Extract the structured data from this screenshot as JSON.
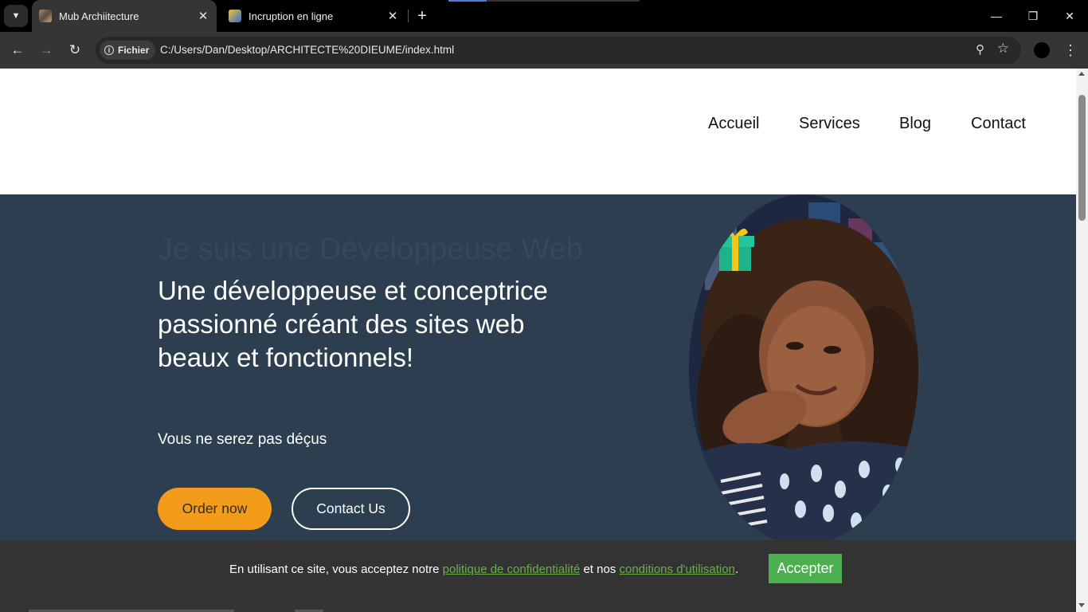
{
  "browser": {
    "tabs": [
      {
        "title": "Mub Archiitecture",
        "active": true
      },
      {
        "title": "Incruption en ligne",
        "active": false
      }
    ],
    "site_chip": "Fichier",
    "url": "C:/Users/Dan/Desktop/ARCHITECTE%20DIEUME/index.html",
    "icons": {
      "tab_list": "chevron-down-icon",
      "close": "close-icon",
      "new_tab": "plus-icon",
      "back": "arrow-left-icon",
      "forward": "arrow-right-icon",
      "reload": "reload-icon",
      "zoom": "zoom-icon",
      "bookmark": "star-icon",
      "menu": "kebab-menu-icon"
    }
  },
  "nav": {
    "links": [
      "Accueil",
      "Services",
      "Blog",
      "Contact"
    ]
  },
  "hero": {
    "typed_text": "Je suis une Développeuse Web",
    "title": "Une développeuse et conceptrice passionné créant des sites web beaux et fonctionnels!",
    "subtitle": "Vous ne serez pas déçus",
    "order_button": "Order now",
    "contact_button": "Contact Us",
    "colors": {
      "background": "#2c3e50",
      "order_button": "#f39c1c"
    }
  },
  "cookie_banner": {
    "text_before": "En utilisant ce site, vous acceptez notre ",
    "privacy_link": "politique de confidentialité",
    "text_middle": " et nos ",
    "terms_link": "conditions d'utilisation",
    "text_after": ".",
    "accept_button": "Accepter",
    "colors": {
      "background": "#333333",
      "link": "#6ab04c",
      "button": "#4caf50"
    }
  }
}
